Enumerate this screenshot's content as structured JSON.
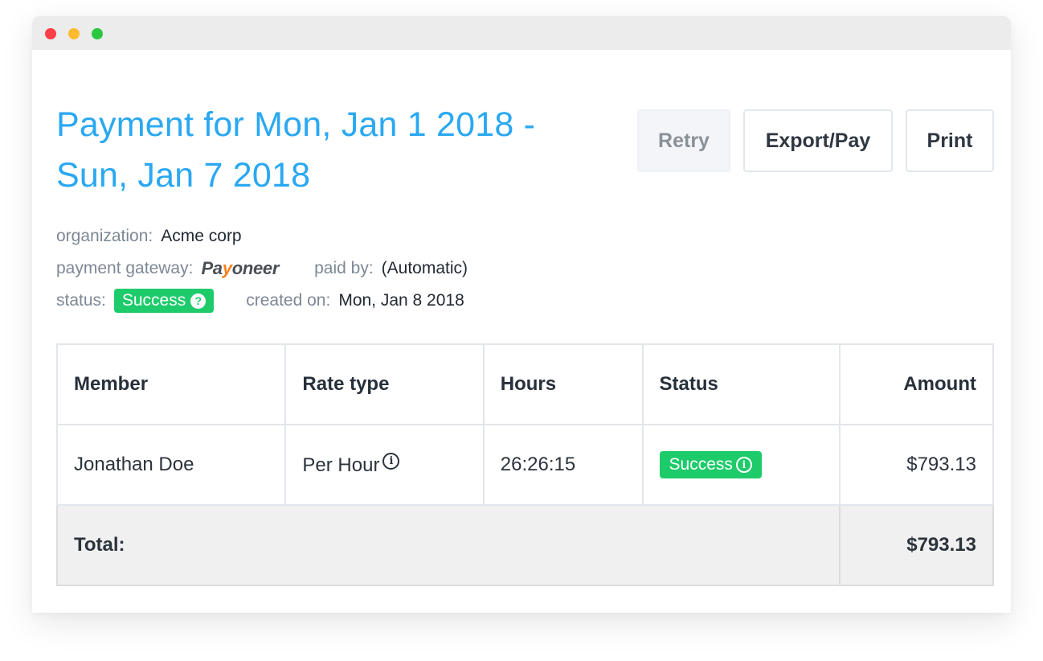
{
  "window": {
    "controls": [
      "close",
      "minimize",
      "maximize"
    ]
  },
  "header": {
    "title": "Payment for Mon, Jan 1 2018 - Sun, Jan 7 2018",
    "actions": {
      "retry": "Retry",
      "export_pay": "Export/Pay",
      "print": "Print"
    }
  },
  "meta": {
    "organization_label": "organization:",
    "organization": "Acme corp",
    "gateway_label": "payment gateway:",
    "gateway_logo_a": "Pa",
    "gateway_logo_y": "y",
    "gateway_logo_b": "oneer",
    "paid_by_label": "paid by:",
    "paid_by": "(Automatic)",
    "status_label": "status:",
    "status": "Success",
    "status_icon": "?",
    "created_label": "created on:",
    "created": "Mon, Jan 8 2018"
  },
  "table": {
    "columns": [
      "Member",
      "Rate type",
      "Hours",
      "Status",
      "Amount"
    ],
    "rows": [
      {
        "member": "Jonathan Doe",
        "rate_type": "Per Hour",
        "hours": "26:26:15",
        "status": "Success",
        "amount": "$793.13"
      }
    ],
    "total_label": "Total:",
    "total": "$793.13",
    "info_icon": "i"
  },
  "colors": {
    "accent": "#2aa8f2",
    "success": "#1ecb6b"
  }
}
